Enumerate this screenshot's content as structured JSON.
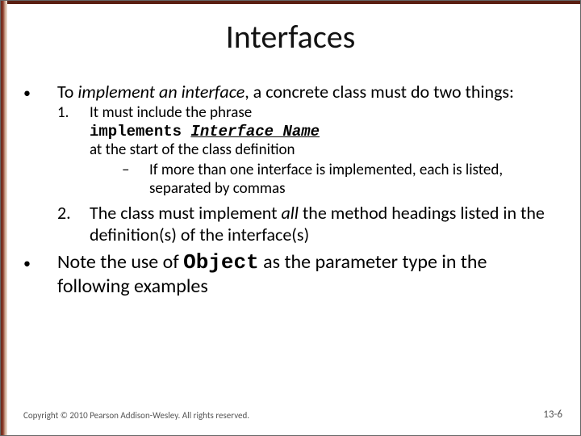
{
  "title": "Interfaces",
  "bullets": {
    "intro_pre": "To ",
    "intro_em": "implement an interface",
    "intro_post": ", a concrete class must do two things:",
    "item1": {
      "num": "1.",
      "line1": "It must include the phrase",
      "code_prefix": "implements ",
      "code_iname": "Interface_Name",
      "line3": "at the start of the class definition",
      "dash": "–",
      "sub": "If more than one interface is implemented, each is listed, separated by commas"
    },
    "item2": {
      "num": "2.",
      "pre": "The class must implement ",
      "em": "all",
      "post": " the method headings listed in the definition(s) of the interface(s)"
    },
    "note_pre": "Note the use of ",
    "note_code": "Object",
    "note_post": " as the parameter type in the following examples"
  },
  "footer": {
    "copyright": "Copyright © 2010 Pearson Addison-Wesley. All rights reserved.",
    "page": "13-6"
  }
}
